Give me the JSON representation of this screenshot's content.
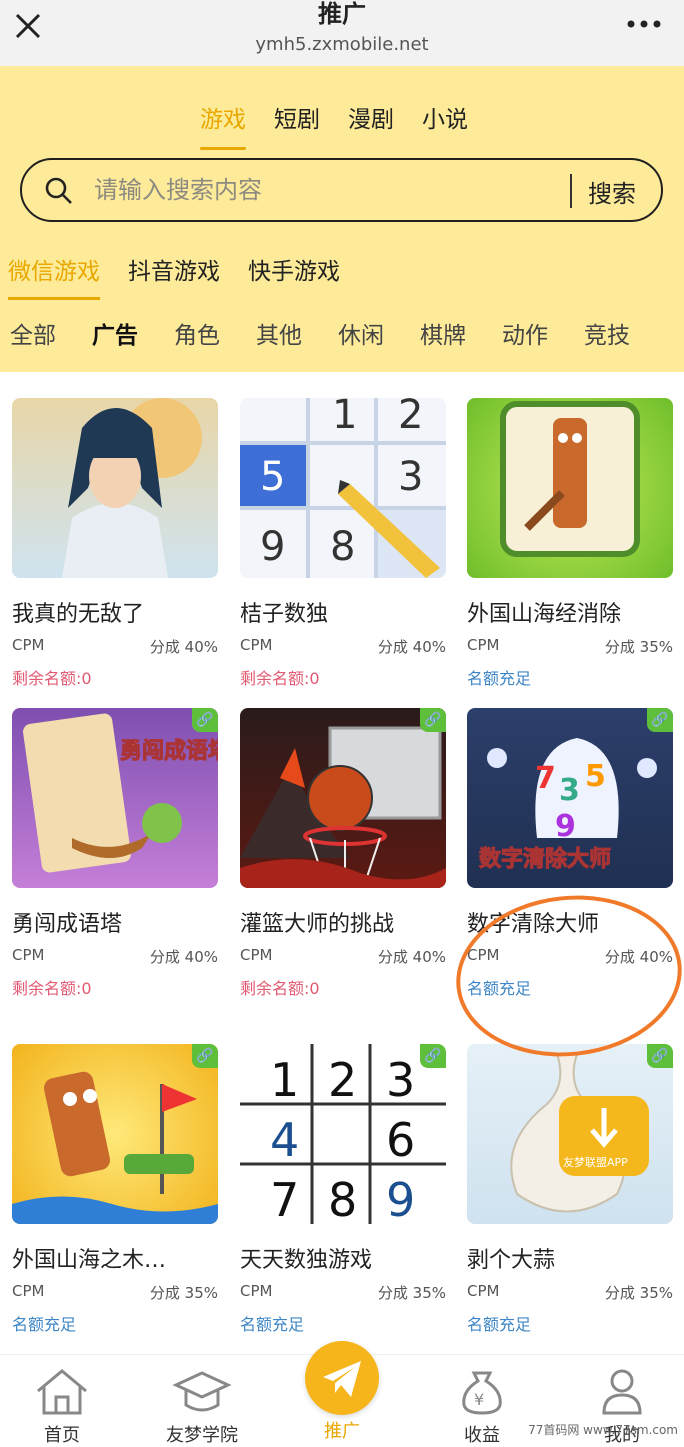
{
  "header": {
    "title": "推广",
    "url": "ymh5.zxmobile.net"
  },
  "content_tabs": [
    {
      "label": "游戏",
      "active": true
    },
    {
      "label": "短剧",
      "active": false
    },
    {
      "label": "漫剧",
      "active": false
    },
    {
      "label": "小说",
      "active": false
    }
  ],
  "search": {
    "placeholder": "请输入搜索内容",
    "button": "搜索"
  },
  "platform_tabs": [
    {
      "label": "微信游戏",
      "active": true
    },
    {
      "label": "抖音游戏",
      "active": false
    },
    {
      "label": "快手游戏",
      "active": false
    }
  ],
  "categories": [
    "全部",
    "广告",
    "角色",
    "其他",
    "休闲",
    "棋牌",
    "动作",
    "竞技"
  ],
  "active_category": "广告",
  "games": [
    {
      "name": "我真的无敌了",
      "model": "CPM",
      "share": "分成 40%",
      "quota": "剩余名额:0",
      "quota_status": "low",
      "badge": false
    },
    {
      "name": "桔子数独",
      "model": "CPM",
      "share": "分成 40%",
      "quota": "剩余名额:0",
      "quota_status": "low",
      "badge": false
    },
    {
      "name": "外国山海经消除",
      "model": "CPM",
      "share": "分成 35%",
      "quota": "名额充足",
      "quota_status": "ok",
      "badge": false
    },
    {
      "name": "勇闯成语塔",
      "model": "CPM",
      "share": "分成 40%",
      "quota": "剩余名额:0",
      "quota_status": "low",
      "badge": true,
      "art_text": "勇闯成语塔"
    },
    {
      "name": "灌篮大师的挑战",
      "model": "CPM",
      "share": "分成 40%",
      "quota": "剩余名额:0",
      "quota_status": "low",
      "badge": true
    },
    {
      "name": "数字清除大师",
      "model": "CPM",
      "share": "分成 40%",
      "quota": "名额充足",
      "quota_status": "ok",
      "badge": true,
      "art_text": "数字清除大师"
    },
    {
      "name": "外国山海之木…",
      "model": "CPM",
      "share": "分成 35%",
      "quota": "名额充足",
      "quota_status": "ok",
      "badge": true
    },
    {
      "name": "天天数独游戏",
      "model": "CPM",
      "share": "分成 35%",
      "quota": "名额充足",
      "quota_status": "ok",
      "badge": true
    },
    {
      "name": "剥个大蒜",
      "model": "CPM",
      "share": "分成 35%",
      "quota": "名额充足",
      "quota_status": "ok",
      "badge": true,
      "art_text": "友梦联盟APP"
    }
  ],
  "bottom_nav": [
    {
      "label": "首页",
      "icon": "home-icon",
      "active": false
    },
    {
      "label": "友梦学院",
      "icon": "academy-icon",
      "active": false
    },
    {
      "label": "推广",
      "icon": "paper-plane-icon",
      "active": true
    },
    {
      "label": "收益",
      "icon": "money-bag-icon",
      "active": false
    },
    {
      "label": "我的",
      "icon": "user-icon",
      "active": false
    }
  ],
  "watermark": "77首码网 www.77sm.com",
  "colors": {
    "accent": "#e9a800",
    "yellow_bg": "#fdeb9a",
    "quota_low": "#e25a72",
    "quota_ok": "#3d86c6",
    "badge": "#5dbf3a",
    "annotation": "#f07a2a"
  }
}
